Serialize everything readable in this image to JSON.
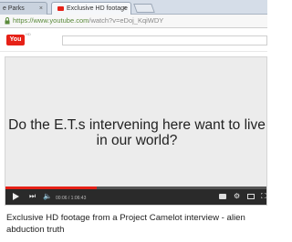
{
  "browser": {
    "tabs": [
      {
        "label": "e Parks",
        "active": false
      },
      {
        "label": "Exclusive HD footage",
        "active": true
      }
    ],
    "close_glyph": "×",
    "url_host": "https://www.youtube.com",
    "url_path": "/watch?v=eDoj_KqiWDY"
  },
  "youtube": {
    "logo_text": "You",
    "logo_sup": "HD",
    "search_placeholder": ""
  },
  "player": {
    "caption": "Do the E.T.s intervening here want to live in our world?",
    "time_display": "00:06 / 1:06:43",
    "progress_fraction": 0.35,
    "accent_color": "#e62117",
    "icons": [
      "play-icon",
      "next-icon",
      "volume-icon",
      "cc-icon",
      "gear-icon",
      "theater-icon",
      "fullscreen-icon"
    ]
  },
  "video": {
    "title": "Exclusive HD footage from a Project Camelot interview - alien abduction truth"
  }
}
